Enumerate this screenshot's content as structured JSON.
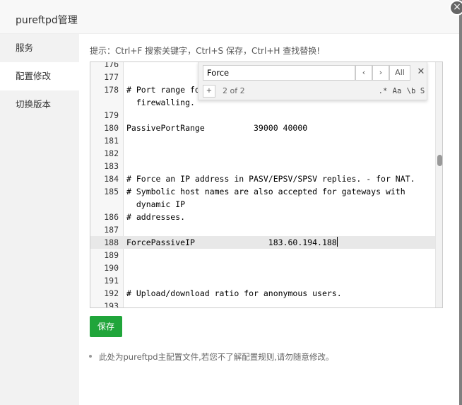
{
  "dialog": {
    "title": "pureftpd管理",
    "close_glyph": "×"
  },
  "sidebar": {
    "items": [
      {
        "label": "服务"
      },
      {
        "label": "配置修改"
      },
      {
        "label": "切换版本"
      }
    ],
    "active_index": 1
  },
  "main": {
    "tip": "提示：Ctrl+F 搜索关键字，Ctrl+S 保存，Ctrl+H 查找替换!",
    "save_label": "保存",
    "note": "此处为pureftpd主配置文件,若您不了解配置规则,请勿随意修改。"
  },
  "search": {
    "value": "Force",
    "prev_glyph": "‹",
    "next_glyph": "›",
    "all_label": "All",
    "close_glyph": "✕",
    "replace_toggle": "+",
    "match_count": "2 of 2",
    "options": [
      ".*",
      "Aa",
      "\\b",
      "S"
    ]
  },
  "editor": {
    "lines": [
      {
        "no": "176",
        "text": ""
      },
      {
        "no": "177",
        "text": ""
      },
      {
        "no": "178",
        "text": "# Port range fo\n  firewalling."
      },
      {
        "no": "179",
        "text": ""
      },
      {
        "no": "180",
        "text": "PassivePortRange          39000 40000"
      },
      {
        "no": "181",
        "text": ""
      },
      {
        "no": "182",
        "text": ""
      },
      {
        "no": "183",
        "text": ""
      },
      {
        "no": "184",
        "text": "# Force an IP address in PASV/EPSV/SPSV replies. - for NAT."
      },
      {
        "no": "185",
        "text": "# Symbolic host names are also accepted for gateways with\n  dynamic IP"
      },
      {
        "no": "186",
        "text": "# addresses."
      },
      {
        "no": "187",
        "text": ""
      },
      {
        "no": "188",
        "text": "ForcePassiveIP               183.60.194.188"
      },
      {
        "no": "189",
        "text": ""
      },
      {
        "no": "190",
        "text": ""
      },
      {
        "no": "191",
        "text": ""
      },
      {
        "no": "192",
        "text": "# Upload/download ratio for anonymous users."
      },
      {
        "no": "193",
        "text": ""
      }
    ]
  },
  "colors": {
    "accent_green": "#20a53a",
    "sidebar_bg": "#f2f2f2"
  }
}
